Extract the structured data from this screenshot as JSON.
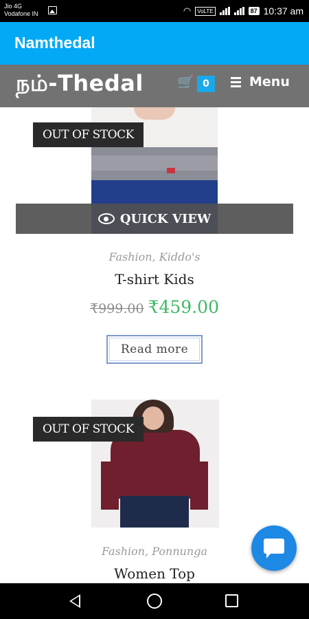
{
  "status_bar": {
    "carrier1": "Jio 4G",
    "carrier2": "Vodafone IN",
    "volte": "VoLTE",
    "battery": "87",
    "time": "10:37 am"
  },
  "app_bar": {
    "title": "Namthedal"
  },
  "site_header": {
    "logo": "நம்-Thedal",
    "cart_count": "0",
    "menu_label": "Menu"
  },
  "products": [
    {
      "badge": "OUT OF STOCK",
      "quick_view": "QUICK VIEW",
      "categories": "Fashion, Kiddo's",
      "title": "T-shirt Kids",
      "price_old": "₹999.00",
      "price_new": "₹459.00",
      "button": "Read more"
    },
    {
      "badge": "OUT OF STOCK",
      "categories": "Fashion, Ponnunga",
      "title": "Women Top"
    }
  ],
  "colors": {
    "app_bar": "#03a9f4",
    "price_new": "#3db861",
    "cart_badge": "#1ba8e8",
    "chat_fab": "#1e88e5"
  },
  "icons": [
    "image-icon",
    "wifi-icon",
    "signal-icon",
    "battery-icon",
    "cart-icon",
    "hamburger-icon",
    "eye-icon",
    "chat-icon",
    "arrow-up-icon",
    "back-icon",
    "home-icon",
    "recent-apps-icon"
  ]
}
